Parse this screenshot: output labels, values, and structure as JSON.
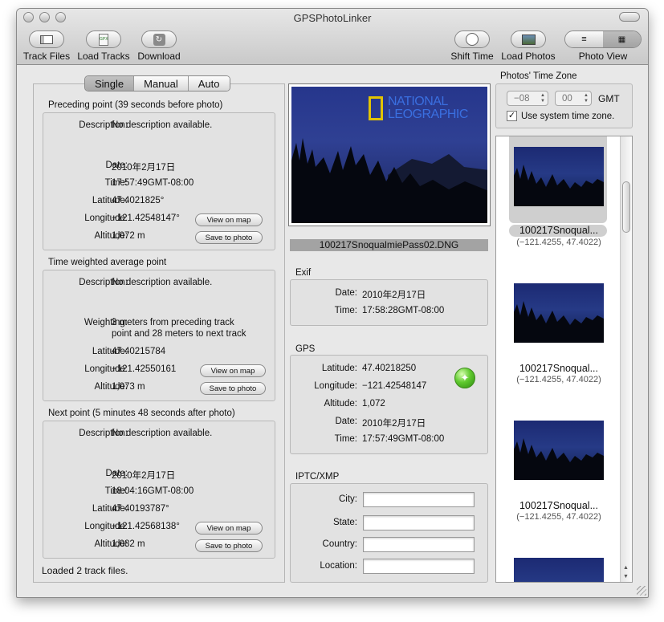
{
  "window": {
    "title": "GPSPhotoLinker"
  },
  "toolbar": {
    "track_files": "Track Files",
    "load_tracks": "Load Tracks",
    "download": "Download",
    "shift_time": "Shift Time",
    "load_photos": "Load Photos",
    "photo_view": "Photo View"
  },
  "mode_tabs": {
    "single": "Single",
    "manual": "Manual",
    "auto": "Auto",
    "selected": "Single"
  },
  "preceding": {
    "header": "Preceding point (39 seconds before photo)",
    "desc_label": "Description:",
    "desc_value": "No description available.",
    "date_label": "Date:",
    "date_value": "2010年2月17日",
    "time_label": "Time:",
    "time_value": "17:57:49GMT-08:00",
    "lat_label": "Latitude:",
    "lat_value": "47.4021825°",
    "lon_label": "Longitude:",
    "lon_value": "−121.42548147°",
    "alt_label": "Altitude:",
    "alt_value": "1,072 m",
    "view_map": "View on map",
    "save_photo": "Save to photo"
  },
  "weighted": {
    "header": "Time weighted average point",
    "desc_label": "Description:",
    "desc_value": "No description available.",
    "weight_label": "Weighting:",
    "weight_line1": "3 meters from preceding track",
    "weight_line2": "point and 28 meters to next track",
    "lat_label": "Latitude:",
    "lat_value": "47.40215784",
    "lon_label": "Longitude:",
    "lon_value": "−121.42550161",
    "alt_label": "Altitude:",
    "alt_value": "1,073 m",
    "view_map": "View on map",
    "save_photo": "Save to photo"
  },
  "next": {
    "header": "Next point (5 minutes 48 seconds after photo)",
    "desc_label": "Description:",
    "desc_value": "No description available.",
    "date_label": "Date:",
    "date_value": "2010年2月17日",
    "time_label": "Time:",
    "time_value": "18:04:16GMT-08:00",
    "lat_label": "Latitude:",
    "lat_value": "47.40193787°",
    "lon_label": "Longitude:",
    "lon_value": "−121.42568138°",
    "alt_label": "Altitude:",
    "alt_value": "1,082 m",
    "view_map": "View on map",
    "save_photo": "Save to photo"
  },
  "status": "Loaded 2 track files.",
  "preview": {
    "filename": "100217SnoqualmiePass02.DNG",
    "watermark_line1": "NATIONAL",
    "watermark_line2": "LEOGRAPHIC"
  },
  "exif": {
    "header": "Exif",
    "date_label": "Date:",
    "date_value": "2010年2月17日",
    "time_label": "Time:",
    "time_value": "17:58:28GMT-08:00"
  },
  "gps": {
    "header": "GPS",
    "lat_label": "Latitude:",
    "lat_value": "47.40218250",
    "lon_label": "Longitude:",
    "lon_value": "−121.42548147",
    "alt_label": "Altitude:",
    "alt_value": "1,072",
    "date_label": "Date:",
    "date_value": "2010年2月17日",
    "time_label": "Time:",
    "time_value": "17:57:49GMT-08:00"
  },
  "iptc": {
    "header": "IPTC/XMP",
    "city_label": "City:",
    "state_label": "State:",
    "country_label": "Country:",
    "location_label": "Location:",
    "city_value": "",
    "state_value": "",
    "country_value": "",
    "location_value": ""
  },
  "timezone": {
    "header": "Photos' Time Zone",
    "hours": "−08",
    "minutes": "00",
    "gmt_label": "GMT",
    "use_system_label": "Use system time zone.",
    "use_system_checked": true
  },
  "photos": [
    {
      "name": "100217Snoqual...",
      "coords": "(−121.4255, 47.4022)",
      "selected": true
    },
    {
      "name": "100217Snoqual...",
      "coords": "(−121.4255, 47.4022)",
      "selected": false
    },
    {
      "name": "100217Snoqual...",
      "coords": "(−121.4255, 47.4022)",
      "selected": false
    }
  ],
  "icons": {
    "track_files": "track-files-icon",
    "load_tracks": "gpx-file-icon",
    "download": "download-icon",
    "shift_time": "clock-icon",
    "load_photos": "photo-icon",
    "photo_view_list": "list-icon",
    "photo_view_grid": "grid-icon",
    "globe": "globe-icon"
  },
  "colors": {
    "window_bg": "#e8e8e8",
    "photo_sky": "#1f3180",
    "globe": "#5fc92e",
    "selection": "#cfcfcf"
  }
}
